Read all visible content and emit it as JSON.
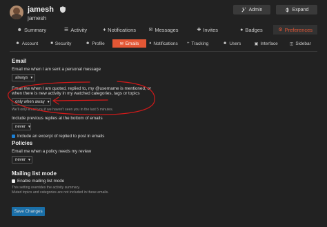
{
  "user": {
    "username": "jamesh",
    "name": "jamesh"
  },
  "header": {
    "admin_label": "Admin",
    "expand_label": "Expand"
  },
  "main_nav": [
    {
      "label": "Summary",
      "icon": "user-icon"
    },
    {
      "label": "Activity",
      "icon": "list-icon"
    },
    {
      "label": "Notifications",
      "icon": "bell-icon"
    },
    {
      "label": "Messages",
      "icon": "envelope-icon"
    },
    {
      "label": "Invites",
      "icon": "user-plus-icon"
    },
    {
      "label": "Badges",
      "icon": "badge-icon"
    },
    {
      "label": "Preferences",
      "icon": "gear-icon",
      "active": true
    }
  ],
  "sub_nav": [
    {
      "label": "Account",
      "icon": "user-icon"
    },
    {
      "label": "Security",
      "icon": "lock-icon"
    },
    {
      "label": "Profile",
      "icon": "user-icon"
    },
    {
      "label": "Emails",
      "icon": "envelope-icon",
      "active": true
    },
    {
      "label": "Notifications",
      "icon": "bell-icon"
    },
    {
      "label": "Tracking",
      "icon": "plus-icon"
    },
    {
      "label": "Users",
      "icon": "users-icon"
    },
    {
      "label": "Interface",
      "icon": "desktop-icon"
    },
    {
      "label": "Sidebar",
      "icon": "sidebar-icon"
    }
  ],
  "email": {
    "title": "Email",
    "personal_message_label": "Email me when I am sent a personal message",
    "personal_message_value": "always",
    "quoted_label_line1": "Email me when I am quoted, replied to, my @username is mentioned, or",
    "quoted_label_line2": "when there is new activity in my watched categories, tags or topics",
    "quoted_value": "only when away",
    "quoted_hint": "We'll only email you if we haven't seen you in the last 5 minutes.",
    "previous_replies_label": "Include previous replies at the bottom of emails",
    "previous_replies_value": "never",
    "excerpt_label": "Include an excerpt of replied to post in emails",
    "excerpt_checked": true
  },
  "policies": {
    "title": "Policies",
    "label": "Email me when a policy needs my review",
    "value": "never"
  },
  "mailing_list": {
    "title": "Mailing list mode",
    "enable_label": "Enable mailing list mode",
    "enable_checked": false,
    "hint_line1": "This setting overrides the activity summary.",
    "hint_line2": "Muted topics and categories are not included in these emails."
  },
  "save_label": "Save Changes",
  "colors": {
    "accent": "#e45735",
    "primary_button": "#1a6fa8",
    "annotation": "#d11a1a",
    "checkbox": "#1a7fd6"
  }
}
